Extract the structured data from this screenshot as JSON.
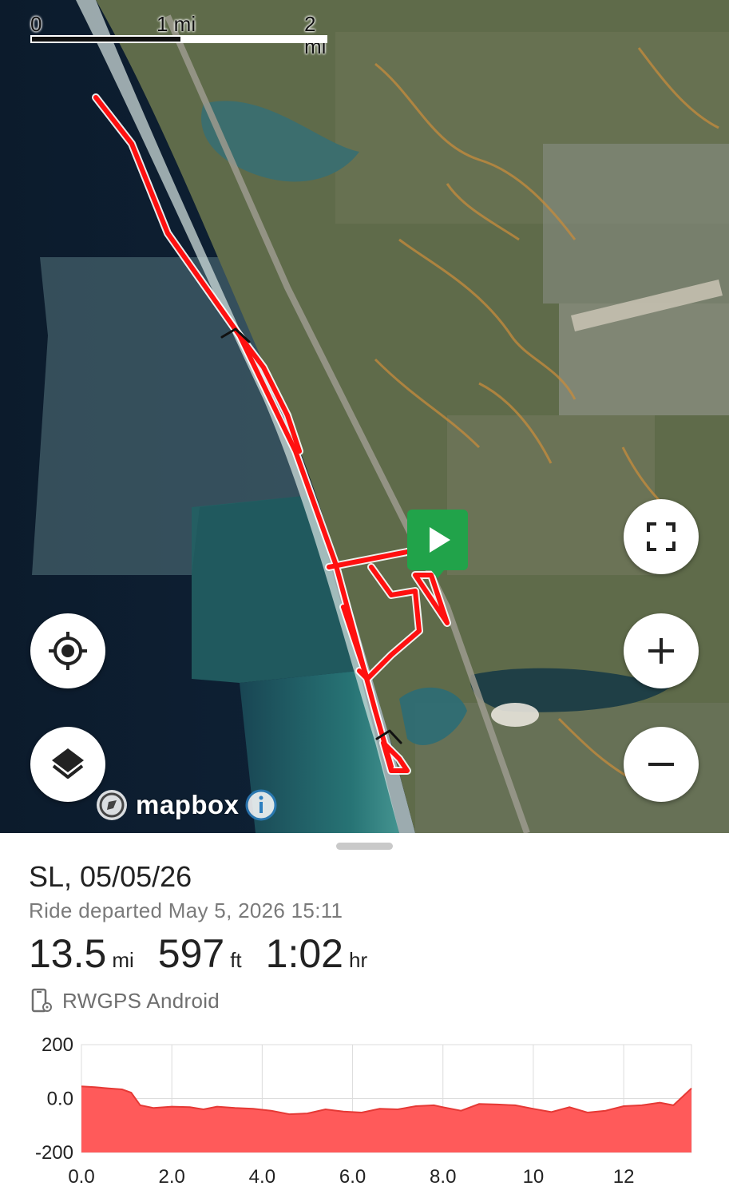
{
  "map": {
    "scale": {
      "labels": [
        "0",
        "1 mi",
        "2 mi"
      ]
    },
    "attribution": {
      "brand": "mapbox"
    },
    "colors": {
      "route": "#ff0000",
      "start": "#21a34a",
      "ocean_deep": "#0e2235",
      "ocean_shallow": "#1f6b70",
      "land": "#5b6a45"
    },
    "controls": [
      "locate-button",
      "layers-button",
      "fullscreen-button",
      "zoom-in-button",
      "zoom-out-button"
    ]
  },
  "ride": {
    "title": "SL, 05/05/26",
    "subtitle": "Ride departed May 5, 2026 15:11",
    "distance": "13.5",
    "distance_unit": "mi",
    "elevation": "597",
    "elevation_unit": "ft",
    "duration": "1:02",
    "duration_unit": "hr",
    "device": "RWGPS Android"
  },
  "chart_data": {
    "type": "area",
    "color": "#ff5a5a",
    "x": [
      0,
      0.3,
      0.6,
      0.9,
      1.1,
      1.3,
      1.6,
      2.0,
      2.4,
      2.7,
      3.0,
      3.4,
      3.8,
      4.2,
      4.6,
      5.0,
      5.4,
      5.8,
      6.2,
      6.6,
      7.0,
      7.4,
      7.8,
      8.0,
      8.4,
      8.8,
      9.2,
      9.6,
      10.0,
      10.4,
      10.8,
      11.2,
      11.6,
      12.0,
      12.4,
      12.8,
      13.1,
      13.5
    ],
    "y": [
      45,
      42,
      38,
      34,
      22,
      -25,
      -35,
      -30,
      -32,
      -40,
      -30,
      -35,
      -38,
      -45,
      -58,
      -55,
      -40,
      -48,
      -52,
      -38,
      -40,
      -28,
      -25,
      -32,
      -45,
      -20,
      -22,
      -25,
      -38,
      -50,
      -32,
      -52,
      -45,
      -28,
      -25,
      -15,
      -25,
      38
    ],
    "xticks": [
      "0.0",
      "2.0",
      "4.0",
      "6.0",
      "8.0",
      "10",
      "12"
    ],
    "xtick_values": [
      0,
      2,
      4,
      6,
      8,
      10,
      12
    ],
    "yticks": [
      "200",
      "0.0",
      "-200"
    ],
    "ytick_values": [
      200,
      0,
      -200
    ],
    "xlim": [
      0,
      13.5
    ],
    "ylim": [
      -200,
      200
    ],
    "grid": true
  }
}
